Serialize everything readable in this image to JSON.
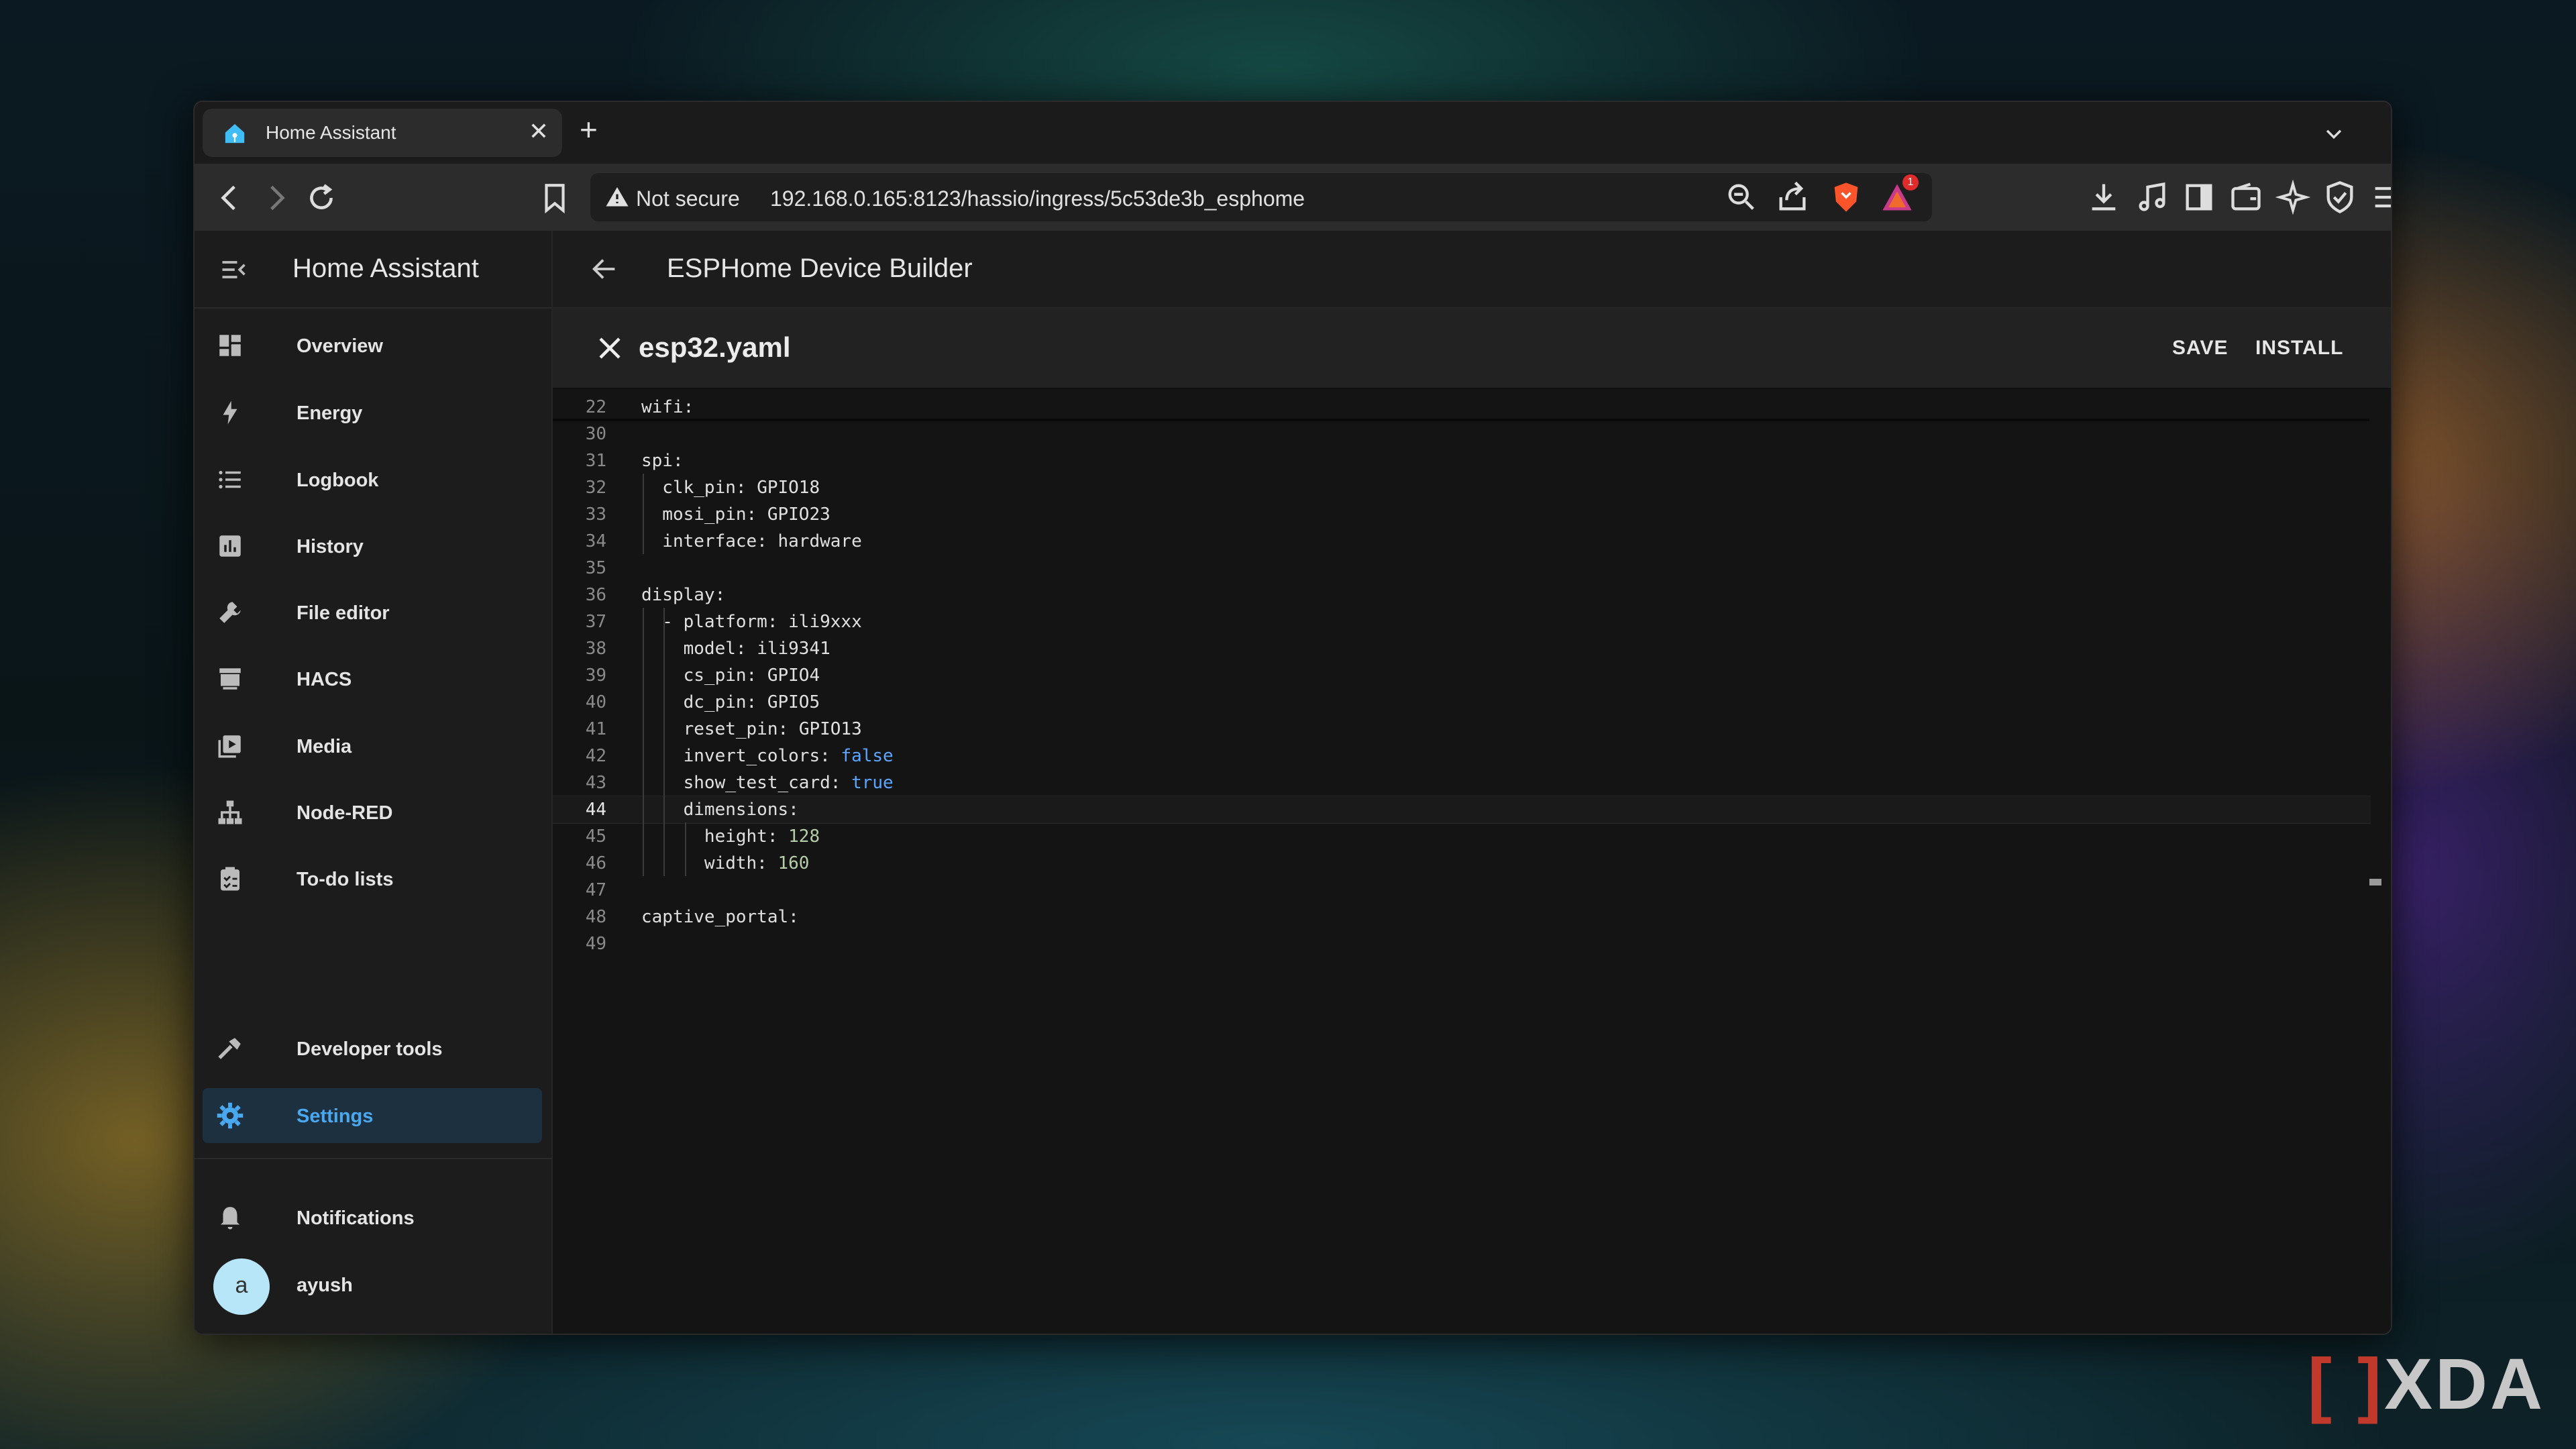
{
  "browser": {
    "tab_title": "Home Assistant",
    "tab_close": "✕",
    "new_tab": "+",
    "url_security": "Not secure",
    "url": "192.168.0.165:8123/hassio/ingress/5c53de3b_esphome",
    "notification_badge": "1"
  },
  "sidebar": {
    "title": "Home Assistant",
    "items": [
      {
        "label": "Overview",
        "icon": "dashboard-icon"
      },
      {
        "label": "Energy",
        "icon": "lightning-icon"
      },
      {
        "label": "Logbook",
        "icon": "list-icon"
      },
      {
        "label": "History",
        "icon": "chart-icon"
      },
      {
        "label": "File editor",
        "icon": "wrench-icon"
      },
      {
        "label": "HACS",
        "icon": "hacs-icon"
      },
      {
        "label": "Media",
        "icon": "media-icon"
      },
      {
        "label": "Node-RED",
        "icon": "sitemap-icon"
      },
      {
        "label": "To-do lists",
        "icon": "clipboard-icon"
      }
    ],
    "developer_tools": "Developer tools",
    "settings": "Settings",
    "notifications": "Notifications",
    "user_initial": "a",
    "user_name": "ayush"
  },
  "main": {
    "title": "ESPHome Device Builder",
    "file_name": "esp32.yaml",
    "save_label": "SAVE",
    "install_label": "INSTALL"
  },
  "code_lines": [
    {
      "n": "22",
      "k": "wifi:",
      "v": "",
      "t": ""
    },
    {
      "n": "30",
      "k": "",
      "v": "",
      "t": ""
    },
    {
      "n": "31",
      "k": "spi:",
      "v": "",
      "t": ""
    },
    {
      "n": "32",
      "k": "  clk_pin: ",
      "v": "GPIO18",
      "t": "str"
    },
    {
      "n": "33",
      "k": "  mosi_pin: ",
      "v": "GPIO23",
      "t": "str"
    },
    {
      "n": "34",
      "k": "  interface: ",
      "v": "hardware",
      "t": "str"
    },
    {
      "n": "35",
      "k": "",
      "v": "",
      "t": ""
    },
    {
      "n": "36",
      "k": "display:",
      "v": "",
      "t": ""
    },
    {
      "n": "37",
      "k": "  - platform: ",
      "v": "ili9xxx",
      "t": "str"
    },
    {
      "n": "38",
      "k": "    model: ",
      "v": "ili9341",
      "t": "str"
    },
    {
      "n": "39",
      "k": "    cs_pin: ",
      "v": "GPIO4",
      "t": "str"
    },
    {
      "n": "40",
      "k": "    dc_pin: ",
      "v": "GPIO5",
      "t": "str"
    },
    {
      "n": "41",
      "k": "    reset_pin: ",
      "v": "GPIO13",
      "t": "str"
    },
    {
      "n": "42",
      "k": "    invert_colors: ",
      "v": "false",
      "t": "kw"
    },
    {
      "n": "43",
      "k": "    show_test_card: ",
      "v": "true",
      "t": "kw"
    },
    {
      "n": "44",
      "k": "    dimensions:",
      "v": "",
      "t": ""
    },
    {
      "n": "45",
      "k": "      height: ",
      "v": "128",
      "t": "num"
    },
    {
      "n": "46",
      "k": "      width: ",
      "v": "160",
      "t": "num"
    },
    {
      "n": "47",
      "k": "",
      "v": "",
      "t": ""
    },
    {
      "n": "48",
      "k": "captive_portal:",
      "v": "",
      "t": ""
    },
    {
      "n": "49",
      "k": "",
      "v": "",
      "t": ""
    }
  ],
  "current_line": "44",
  "watermark": {
    "bracket": "[ ]",
    "text": "XDA"
  }
}
